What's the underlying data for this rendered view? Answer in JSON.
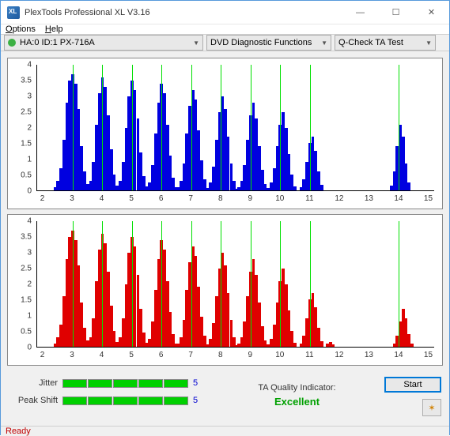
{
  "window": {
    "title": "PlexTools Professional XL V3.16"
  },
  "menu": {
    "options": "Options",
    "help": "Help"
  },
  "toolbar": {
    "device": "HA:0 ID:1  PX-716A",
    "fn": "DVD Diagnostic Functions",
    "test": "Q-Check TA Test"
  },
  "quality": {
    "jitter_label": "Jitter",
    "jitter_val": "5",
    "peak_label": "Peak Shift",
    "peak_val": "5",
    "ind_label": "TA Quality Indicator:",
    "ind_val": "Excellent",
    "start": "Start"
  },
  "status": {
    "text": "Ready"
  },
  "axes": {
    "y": [
      "0",
      "0.5",
      "1",
      "1.5",
      "2",
      "2.5",
      "3",
      "3.5",
      "4"
    ],
    "x": [
      "2",
      "3",
      "4",
      "5",
      "6",
      "7",
      "8",
      "9",
      "10",
      "11",
      "12",
      "13",
      "14",
      "15"
    ]
  },
  "chart_data": [
    {
      "type": "bar",
      "color": "#0000e0",
      "ylim": [
        0,
        4
      ],
      "xrange": [
        1.8,
        15.2
      ],
      "series": [
        {
          "center": 3,
          "bars": [
            [
              2.4,
              0.1
            ],
            [
              2.5,
              0.3
            ],
            [
              2.6,
              0.7
            ],
            [
              2.7,
              1.6
            ],
            [
              2.8,
              2.8
            ],
            [
              2.9,
              3.5
            ],
            [
              3.0,
              3.7
            ],
            [
              3.1,
              3.4
            ],
            [
              3.2,
              2.6
            ],
            [
              3.3,
              1.4
            ],
            [
              3.4,
              0.6
            ],
            [
              3.5,
              0.2
            ],
            [
              3.6,
              0.05
            ]
          ]
        },
        {
          "center": 4,
          "bars": [
            [
              3.5,
              0.05
            ],
            [
              3.6,
              0.3
            ],
            [
              3.7,
              0.9
            ],
            [
              3.8,
              2.1
            ],
            [
              3.9,
              3.1
            ],
            [
              4.0,
              3.6
            ],
            [
              4.1,
              3.3
            ],
            [
              4.2,
              2.4
            ],
            [
              4.3,
              1.3
            ],
            [
              4.4,
              0.5
            ],
            [
              4.5,
              0.15
            ]
          ]
        },
        {
          "center": 5,
          "bars": [
            [
              4.5,
              0.1
            ],
            [
              4.6,
              0.3
            ],
            [
              4.7,
              0.9
            ],
            [
              4.8,
              2.0
            ],
            [
              4.9,
              3.0
            ],
            [
              5.0,
              3.5
            ],
            [
              5.1,
              3.2
            ],
            [
              5.2,
              2.3
            ],
            [
              5.3,
              1.2
            ],
            [
              5.4,
              0.45
            ],
            [
              5.5,
              0.12
            ]
          ]
        },
        {
          "center": 6,
          "bars": [
            [
              5.5,
              0.08
            ],
            [
              5.6,
              0.25
            ],
            [
              5.7,
              0.8
            ],
            [
              5.8,
              1.8
            ],
            [
              5.9,
              2.8
            ],
            [
              6.0,
              3.4
            ],
            [
              6.1,
              3.1
            ],
            [
              6.2,
              2.1
            ],
            [
              6.3,
              1.1
            ],
            [
              6.4,
              0.4
            ],
            [
              6.5,
              0.1
            ]
          ]
        },
        {
          "center": 7,
          "bars": [
            [
              6.55,
              0.1
            ],
            [
              6.65,
              0.3
            ],
            [
              6.75,
              0.85
            ],
            [
              6.85,
              1.8
            ],
            [
              6.95,
              2.7
            ],
            [
              7.05,
              3.2
            ],
            [
              7.15,
              2.9
            ],
            [
              7.25,
              1.9
            ],
            [
              7.35,
              0.95
            ],
            [
              7.45,
              0.35
            ],
            [
              7.55,
              0.08
            ]
          ]
        },
        {
          "center": 8,
          "bars": [
            [
              7.55,
              0.08
            ],
            [
              7.65,
              0.25
            ],
            [
              7.75,
              0.75
            ],
            [
              7.85,
              1.6
            ],
            [
              7.95,
              2.5
            ],
            [
              8.05,
              3.0
            ],
            [
              8.15,
              2.6
            ],
            [
              8.25,
              1.7
            ],
            [
              8.35,
              0.85
            ],
            [
              8.45,
              0.3
            ],
            [
              8.55,
              0.06
            ]
          ]
        },
        {
          "center": 9,
          "bars": [
            [
              8.6,
              0.1
            ],
            [
              8.7,
              0.3
            ],
            [
              8.8,
              0.8
            ],
            [
              8.9,
              1.6
            ],
            [
              9.0,
              2.4
            ],
            [
              9.1,
              2.8
            ],
            [
              9.2,
              2.3
            ],
            [
              9.3,
              1.4
            ],
            [
              9.4,
              0.65
            ],
            [
              9.5,
              0.2
            ]
          ]
        },
        {
          "center": 10,
          "bars": [
            [
              9.6,
              0.08
            ],
            [
              9.7,
              0.25
            ],
            [
              9.8,
              0.7
            ],
            [
              9.9,
              1.4
            ],
            [
              10.0,
              2.1
            ],
            [
              10.1,
              2.5
            ],
            [
              10.2,
              2.0
            ],
            [
              10.3,
              1.15
            ],
            [
              10.4,
              0.5
            ],
            [
              10.5,
              0.12
            ]
          ]
        },
        {
          "center": 11,
          "bars": [
            [
              10.7,
              0.1
            ],
            [
              10.8,
              0.35
            ],
            [
              10.9,
              0.9
            ],
            [
              11.0,
              1.5
            ],
            [
              11.1,
              1.7
            ],
            [
              11.2,
              1.25
            ],
            [
              11.3,
              0.6
            ],
            [
              11.4,
              0.18
            ]
          ]
        },
        {
          "center": 14,
          "bars": [
            [
              13.75,
              0.15
            ],
            [
              13.85,
              0.6
            ],
            [
              13.95,
              1.4
            ],
            [
              14.05,
              2.1
            ],
            [
              14.15,
              1.7
            ],
            [
              14.25,
              0.85
            ],
            [
              14.35,
              0.25
            ]
          ]
        }
      ],
      "markers": [
        3,
        4,
        5,
        6,
        7,
        8,
        9,
        10,
        11,
        14
      ]
    },
    {
      "type": "bar",
      "color": "#e00000",
      "ylim": [
        0,
        4
      ],
      "xrange": [
        1.8,
        15.2
      ],
      "series": [
        {
          "center": 3,
          "bars": [
            [
              2.4,
              0.1
            ],
            [
              2.5,
              0.3
            ],
            [
              2.6,
              0.7
            ],
            [
              2.7,
              1.6
            ],
            [
              2.8,
              2.8
            ],
            [
              2.9,
              3.5
            ],
            [
              3.0,
              3.7
            ],
            [
              3.1,
              3.4
            ],
            [
              3.2,
              2.6
            ],
            [
              3.3,
              1.4
            ],
            [
              3.4,
              0.6
            ],
            [
              3.5,
              0.2
            ],
            [
              3.6,
              0.05
            ]
          ]
        },
        {
          "center": 4,
          "bars": [
            [
              3.5,
              0.05
            ],
            [
              3.6,
              0.3
            ],
            [
              3.7,
              0.9
            ],
            [
              3.8,
              2.1
            ],
            [
              3.9,
              3.1
            ],
            [
              4.0,
              3.6
            ],
            [
              4.1,
              3.3
            ],
            [
              4.2,
              2.4
            ],
            [
              4.3,
              1.3
            ],
            [
              4.4,
              0.5
            ],
            [
              4.5,
              0.15
            ]
          ]
        },
        {
          "center": 5,
          "bars": [
            [
              4.5,
              0.1
            ],
            [
              4.6,
              0.3
            ],
            [
              4.7,
              0.9
            ],
            [
              4.8,
              2.0
            ],
            [
              4.9,
              3.0
            ],
            [
              5.0,
              3.5
            ],
            [
              5.1,
              3.2
            ],
            [
              5.2,
              2.3
            ],
            [
              5.3,
              1.2
            ],
            [
              5.4,
              0.45
            ],
            [
              5.5,
              0.12
            ]
          ]
        },
        {
          "center": 6,
          "bars": [
            [
              5.5,
              0.08
            ],
            [
              5.6,
              0.25
            ],
            [
              5.7,
              0.8
            ],
            [
              5.8,
              1.8
            ],
            [
              5.9,
              2.8
            ],
            [
              6.0,
              3.4
            ],
            [
              6.1,
              3.1
            ],
            [
              6.2,
              2.1
            ],
            [
              6.3,
              1.1
            ],
            [
              6.4,
              0.4
            ],
            [
              6.5,
              0.1
            ]
          ]
        },
        {
          "center": 7,
          "bars": [
            [
              6.55,
              0.1
            ],
            [
              6.65,
              0.3
            ],
            [
              6.75,
              0.85
            ],
            [
              6.85,
              1.8
            ],
            [
              6.95,
              2.7
            ],
            [
              7.05,
              3.2
            ],
            [
              7.15,
              2.9
            ],
            [
              7.25,
              1.9
            ],
            [
              7.35,
              0.95
            ],
            [
              7.45,
              0.35
            ],
            [
              7.55,
              0.08
            ]
          ]
        },
        {
          "center": 8,
          "bars": [
            [
              7.55,
              0.08
            ],
            [
              7.65,
              0.25
            ],
            [
              7.75,
              0.75
            ],
            [
              7.85,
              1.6
            ],
            [
              7.95,
              2.5
            ],
            [
              8.05,
              3.0
            ],
            [
              8.15,
              2.6
            ],
            [
              8.25,
              1.7
            ],
            [
              8.35,
              0.85
            ],
            [
              8.45,
              0.3
            ],
            [
              8.55,
              0.06
            ]
          ]
        },
        {
          "center": 9,
          "bars": [
            [
              8.6,
              0.1
            ],
            [
              8.7,
              0.3
            ],
            [
              8.8,
              0.8
            ],
            [
              8.9,
              1.6
            ],
            [
              9.0,
              2.4
            ],
            [
              9.1,
              2.8
            ],
            [
              9.2,
              2.3
            ],
            [
              9.3,
              1.4
            ],
            [
              9.4,
              0.65
            ],
            [
              9.5,
              0.2
            ]
          ]
        },
        {
          "center": 10,
          "bars": [
            [
              9.6,
              0.08
            ],
            [
              9.7,
              0.25
            ],
            [
              9.8,
              0.7
            ],
            [
              9.9,
              1.4
            ],
            [
              10.0,
              2.1
            ],
            [
              10.1,
              2.5
            ],
            [
              10.2,
              2.0
            ],
            [
              10.3,
              1.15
            ],
            [
              10.4,
              0.5
            ],
            [
              10.5,
              0.12
            ]
          ]
        },
        {
          "center": 11,
          "bars": [
            [
              10.7,
              0.1
            ],
            [
              10.8,
              0.35
            ],
            [
              10.8,
              0.35
            ],
            [
              10.9,
              0.9
            ],
            [
              11.0,
              1.5
            ],
            [
              11.1,
              1.7
            ],
            [
              11.2,
              1.25
            ],
            [
              11.3,
              0.6
            ],
            [
              11.4,
              0.18
            ],
            [
              11.6,
              0.1
            ],
            [
              11.7,
              0.15
            ],
            [
              11.8,
              0.08
            ]
          ]
        },
        {
          "center": 14,
          "bars": [
            [
              13.85,
              0.1
            ],
            [
              13.95,
              0.35
            ],
            [
              14.05,
              0.8
            ],
            [
              14.15,
              1.2
            ],
            [
              14.25,
              0.9
            ],
            [
              14.35,
              0.4
            ],
            [
              14.45,
              0.1
            ]
          ]
        }
      ],
      "markers": [
        3,
        4,
        5,
        6,
        7,
        8,
        9,
        10,
        11,
        14
      ]
    }
  ]
}
